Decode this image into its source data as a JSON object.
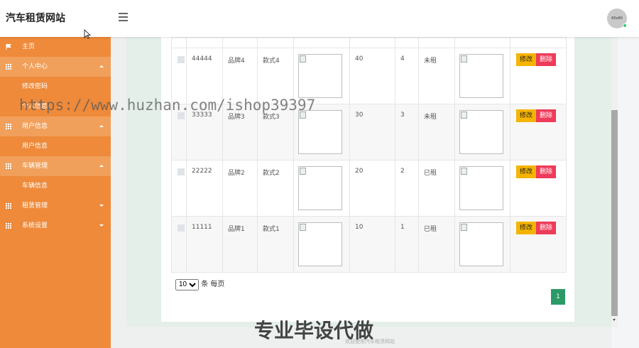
{
  "app": {
    "title": "汽车租赁网站"
  },
  "header": {
    "avatar_text": "60x60"
  },
  "sidebar": {
    "items": [
      {
        "label": "主页",
        "icon": "flag-icon"
      },
      {
        "label": "个人中心",
        "icon": "grid-icon",
        "expanded": true
      },
      {
        "label": "修改密码"
      },
      {
        "label": "个人信息"
      },
      {
        "label": "用户信息",
        "icon": "grid-icon",
        "expanded": true
      },
      {
        "label": "用户信息"
      },
      {
        "label": "车辆管理",
        "icon": "grid-icon",
        "expanded": true
      },
      {
        "label": "车辆信息"
      },
      {
        "label": "租赁管理",
        "icon": "grid-icon",
        "expanded": false
      },
      {
        "label": "系统设置",
        "icon": "grid-icon",
        "expanded": false
      }
    ]
  },
  "table": {
    "rows": [
      {
        "id": "44444",
        "brand": "品牌4",
        "model": "款式4",
        "price": "40",
        "stock": "4",
        "status": "未租"
      },
      {
        "id": "33333",
        "brand": "品牌3",
        "model": "款式3",
        "price": "30",
        "stock": "3",
        "status": "未租"
      },
      {
        "id": "22222",
        "brand": "品牌2",
        "model": "款式2",
        "price": "20",
        "stock": "2",
        "status": "已租"
      },
      {
        "id": "11111",
        "brand": "品牌1",
        "model": "款式1",
        "price": "10",
        "stock": "1",
        "status": "已租"
      }
    ],
    "edit_label": "修改",
    "delete_label": "删除"
  },
  "pagination": {
    "page_size": "10",
    "page_size_suffix": "条 每页",
    "current_page": "1"
  },
  "footer": {
    "text": "欢迎使用汽车租赁网站"
  },
  "overlays": {
    "watermark": "https://www.huzhan.com/ishop39397",
    "stamp": "专业毕设代做"
  },
  "colors": {
    "sidebar": "#ee8a3a",
    "sidebar_group": "#f1a05b",
    "edit_button": "#f5b400",
    "delete_button": "#ee3b5a",
    "page_active": "#2b9a66"
  }
}
